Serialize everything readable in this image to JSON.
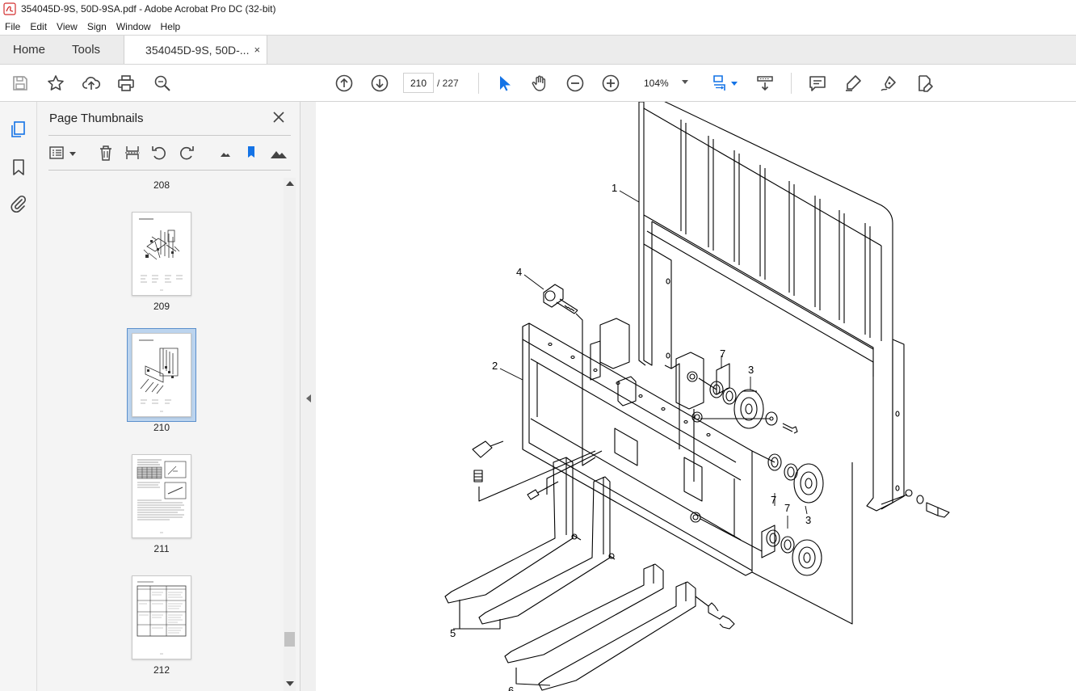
{
  "window": {
    "title": "354045D-9S, 50D-9SA.pdf - Adobe Acrobat Pro DC (32-bit)"
  },
  "menu": [
    "File",
    "Edit",
    "View",
    "Sign",
    "Window",
    "Help"
  ],
  "tabs": {
    "home": "Home",
    "tools": "Tools",
    "document": "354045D-9S, 50D-...",
    "close": "×"
  },
  "toolbar": {
    "page_current": "210",
    "page_total": "/  227",
    "zoom": "104%"
  },
  "panel": {
    "title": "Page Thumbnails",
    "thumbnails": [
      {
        "label": "208"
      },
      {
        "label": "209"
      },
      {
        "label": "210",
        "selected": true
      },
      {
        "label": "211"
      },
      {
        "label": "212"
      }
    ]
  },
  "drawing": {
    "callouts": [
      "1",
      "2",
      "3",
      "3",
      "4",
      "5",
      "6",
      "7",
      "7",
      "7"
    ]
  },
  "colors": {
    "accent": "#1473e6",
    "selection": "#bcd4ee"
  }
}
